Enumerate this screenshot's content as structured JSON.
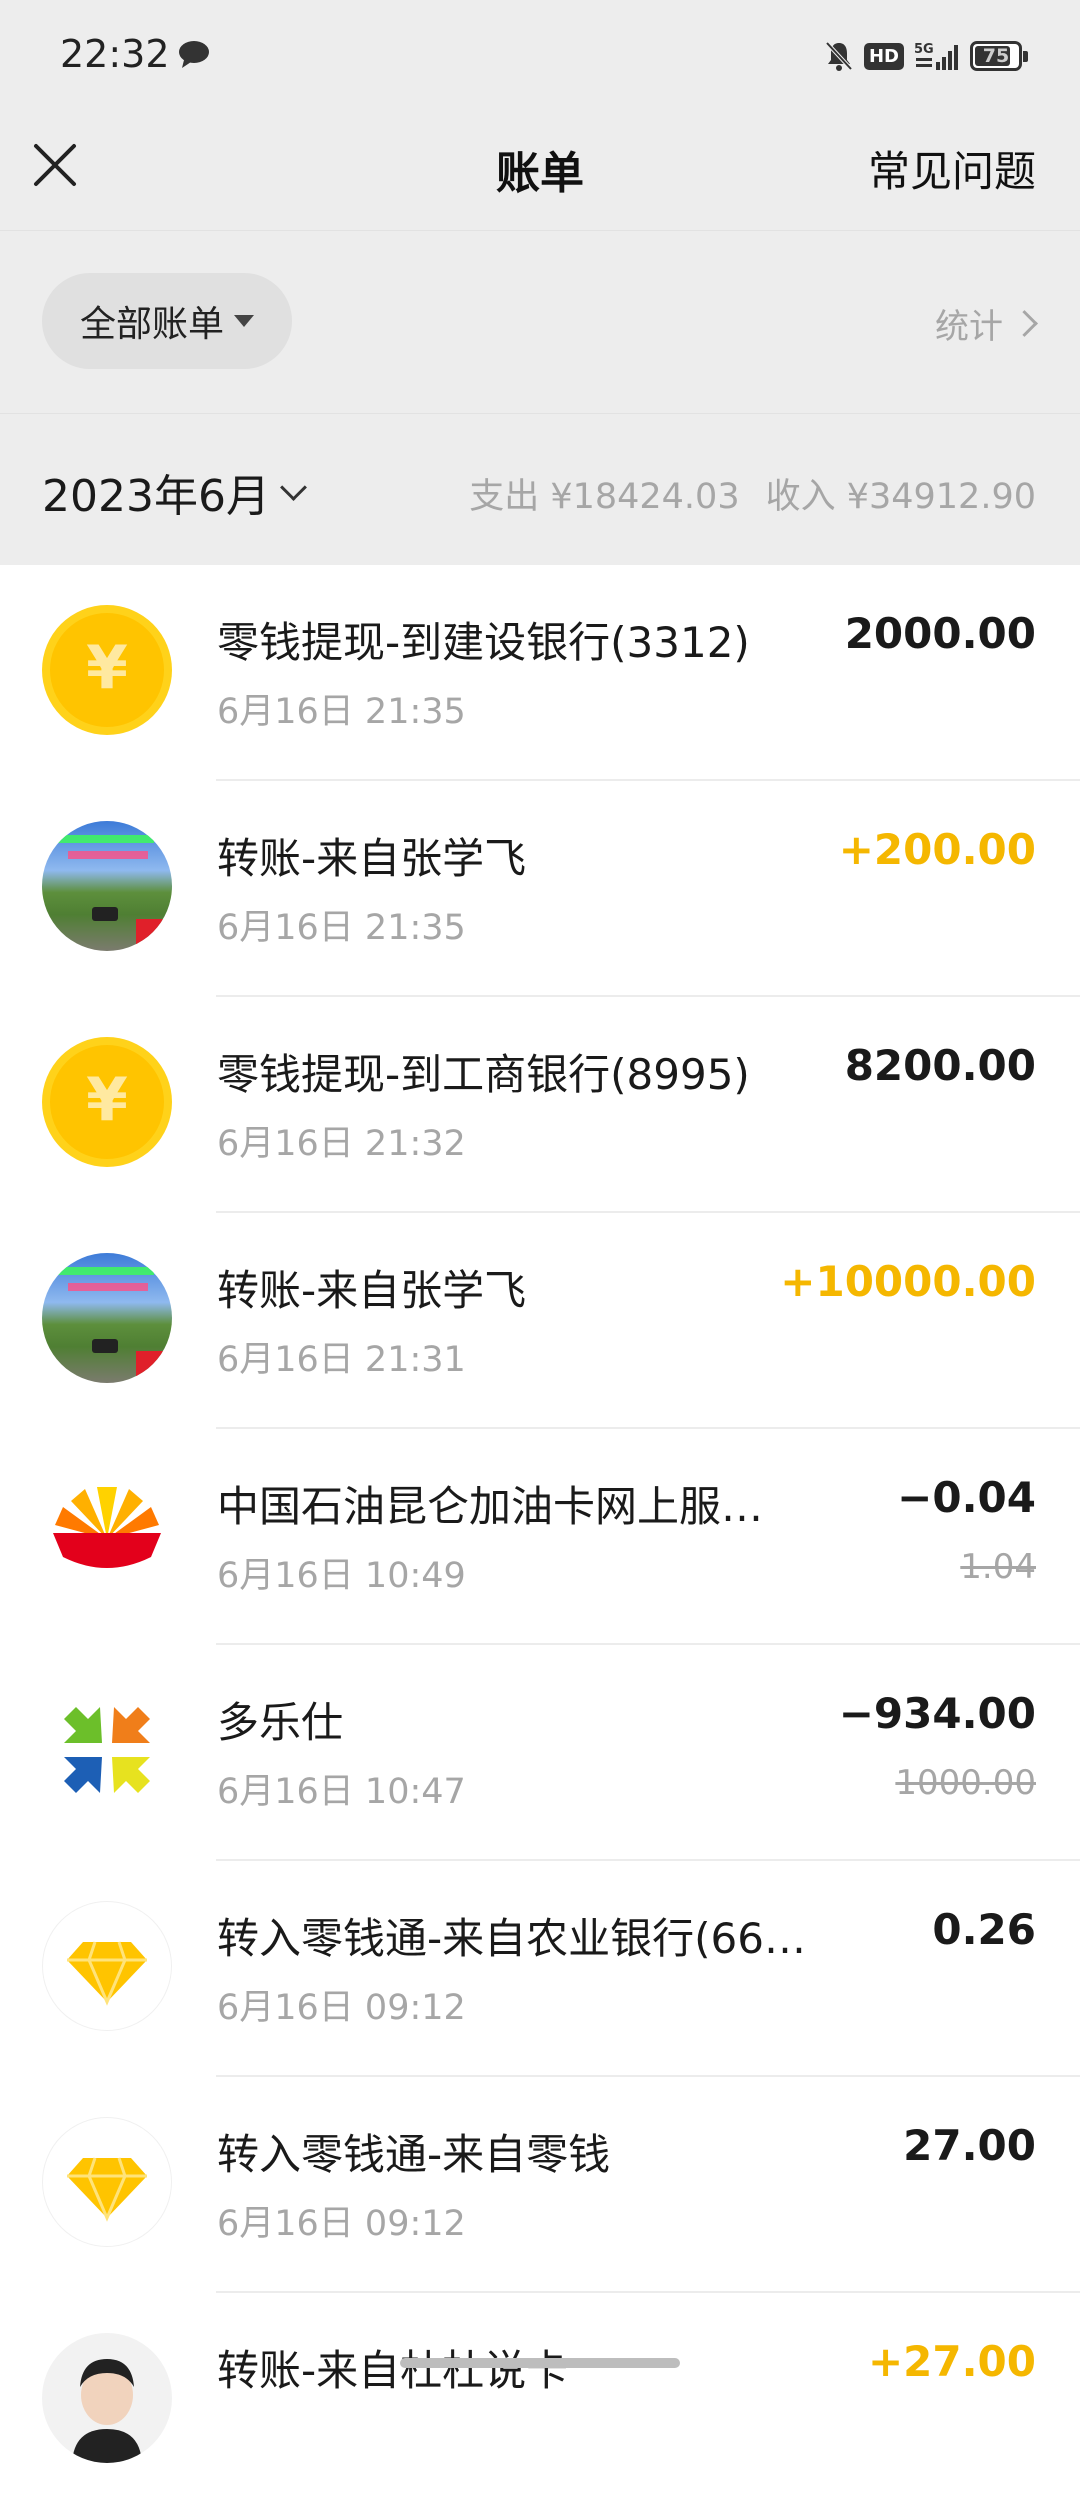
{
  "status_bar": {
    "time": "22:32",
    "battery": "75",
    "icons": [
      "message-bubble-icon",
      "mute-bell-icon",
      "hd-icon",
      "5g-signal-icon",
      "battery-icon"
    ]
  },
  "nav": {
    "title": "账单",
    "right_link": "常见问题",
    "close_icon": "close-icon"
  },
  "filter": {
    "label": "全部账单",
    "stats_label": "统计"
  },
  "month_header": {
    "month": "2023年6月",
    "expense": "支出 ¥18424.03",
    "income": "收入 ¥34912.90"
  },
  "colors": {
    "income": "#f5b700",
    "background": "#ededed",
    "muted": "#a6a6a6"
  },
  "transactions": [
    {
      "title": "零钱提现-到建设银行(3312)",
      "date": "6月16日 21:35",
      "amount": "2000.00",
      "type": "normal",
      "icon": "yen-coin-icon"
    },
    {
      "title": "转账-来自张学飞",
      "date": "6月16日 21:35",
      "amount": "+200.00",
      "type": "income",
      "icon": "user-photo-avatar"
    },
    {
      "title": "零钱提现-到工商银行(8995)",
      "date": "6月16日 21:32",
      "amount": "8200.00",
      "type": "normal",
      "icon": "yen-coin-icon"
    },
    {
      "title": "转账-来自张学飞",
      "date": "6月16日 21:31",
      "amount": "+10000.00",
      "type": "income",
      "icon": "user-photo-avatar"
    },
    {
      "title": "中国石油昆仑加油卡网上服…",
      "date": "6月16日 10:49",
      "amount": "−0.04",
      "original": "1.04",
      "type": "normal",
      "icon": "petrochina-logo-icon"
    },
    {
      "title": "多乐仕",
      "date": "6月16日 10:47",
      "amount": "−934.00",
      "original": "1000.00",
      "type": "normal",
      "icon": "duolesi-logo-icon"
    },
    {
      "title": "转入零钱通-来自农业银行(66…",
      "date": "6月16日 09:12",
      "amount": "0.26",
      "type": "normal",
      "icon": "diamond-icon"
    },
    {
      "title": "转入零钱通-来自零钱",
      "date": "6月16日 09:12",
      "amount": "27.00",
      "type": "normal",
      "icon": "diamond-icon"
    },
    {
      "title": "转账-来自杜杜说卡",
      "date": "",
      "amount": "+27.00",
      "type": "income",
      "icon": "user-photo-avatar"
    }
  ]
}
